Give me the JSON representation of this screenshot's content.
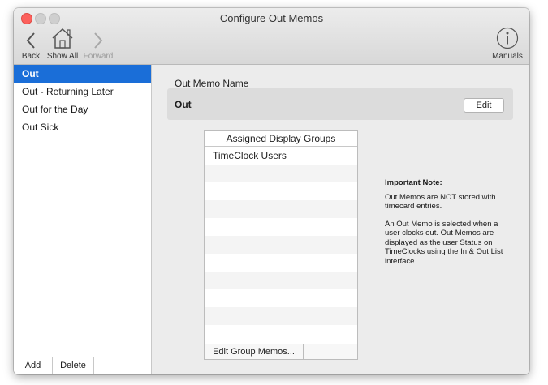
{
  "window": {
    "title": "Configure Out Memos"
  },
  "toolbar": {
    "back_label": "Back",
    "show_all_label": "Show All",
    "forward_label": "Forward",
    "manuals_label": "Manuals"
  },
  "sidebar": {
    "items": [
      {
        "label": "Out",
        "selected": true
      },
      {
        "label": "Out - Returning Later",
        "selected": false
      },
      {
        "label": "Out for the Day",
        "selected": false
      },
      {
        "label": "Out Sick",
        "selected": false
      }
    ],
    "add_label": "Add",
    "delete_label": "Delete"
  },
  "detail": {
    "name_label": "Out Memo Name",
    "name_value": "Out",
    "edit_label": "Edit",
    "groups_header": "Assigned Display Groups",
    "groups": [
      "TimeClock Users"
    ],
    "edit_group_memos_label": "Edit Group Memos..."
  },
  "note": {
    "title": "Important Note:",
    "paragraph1": "Out Memos are NOT stored with timecard entries.",
    "paragraph2": "An Out Memo is selected when a user clocks out. Out Memos are displayed as the user Status on TimeClocks using the In & Out List interface."
  },
  "colors": {
    "selection": "#1a6ed8",
    "close_button": "#fc605c"
  },
  "icons": [
    "chevron-left-icon",
    "home-icon",
    "chevron-right-icon",
    "info-icon"
  ]
}
